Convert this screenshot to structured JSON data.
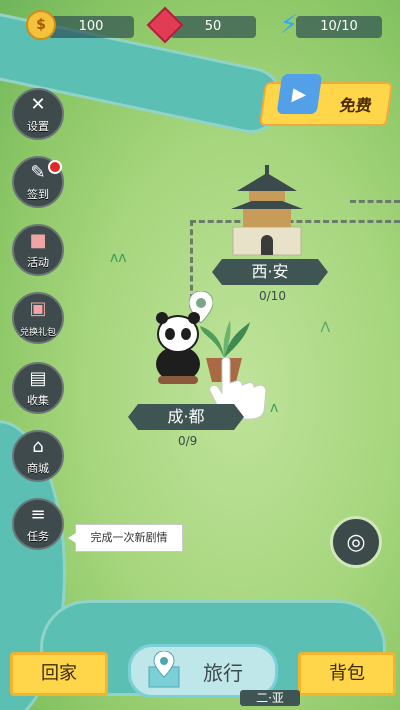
{
  "resources": {
    "coins": {
      "icon": "coin-icon",
      "value": "100"
    },
    "gems": {
      "icon": "gem-icon",
      "value": "50"
    },
    "energy": {
      "icon": "lightning-icon",
      "value": "10/10"
    }
  },
  "free_gift": {
    "label": "免费",
    "icon": "video-gift-icon"
  },
  "left_menu": [
    {
      "label": "设置",
      "icon": "wrench-screwdriver-icon",
      "name": "settings-button"
    },
    {
      "label": "签到",
      "icon": "pencil-icon",
      "name": "check-in-button",
      "badge": true
    },
    {
      "label": "活动",
      "icon": "puzzle-icon",
      "name": "events-button"
    },
    {
      "label": "兑换礼包",
      "icon": "gift-icon",
      "name": "redeem-gift-button"
    },
    {
      "label": "收集",
      "icon": "bag-icon",
      "name": "collection-button"
    },
    {
      "label": "商城",
      "icon": "shop-icon",
      "name": "shop-button"
    },
    {
      "label": "任务",
      "icon": "layers-icon",
      "name": "tasks-button"
    }
  ],
  "cities": [
    {
      "name": "西·安",
      "progress": "0/10"
    },
    {
      "name": "成·都",
      "progress": "0/9"
    }
  ],
  "tooltip": "完成一次新剧情",
  "bottom_nav": {
    "home": "回家",
    "travel": "旅行",
    "backpack": "背包"
  },
  "bottom_strip_text": "二·亚"
}
